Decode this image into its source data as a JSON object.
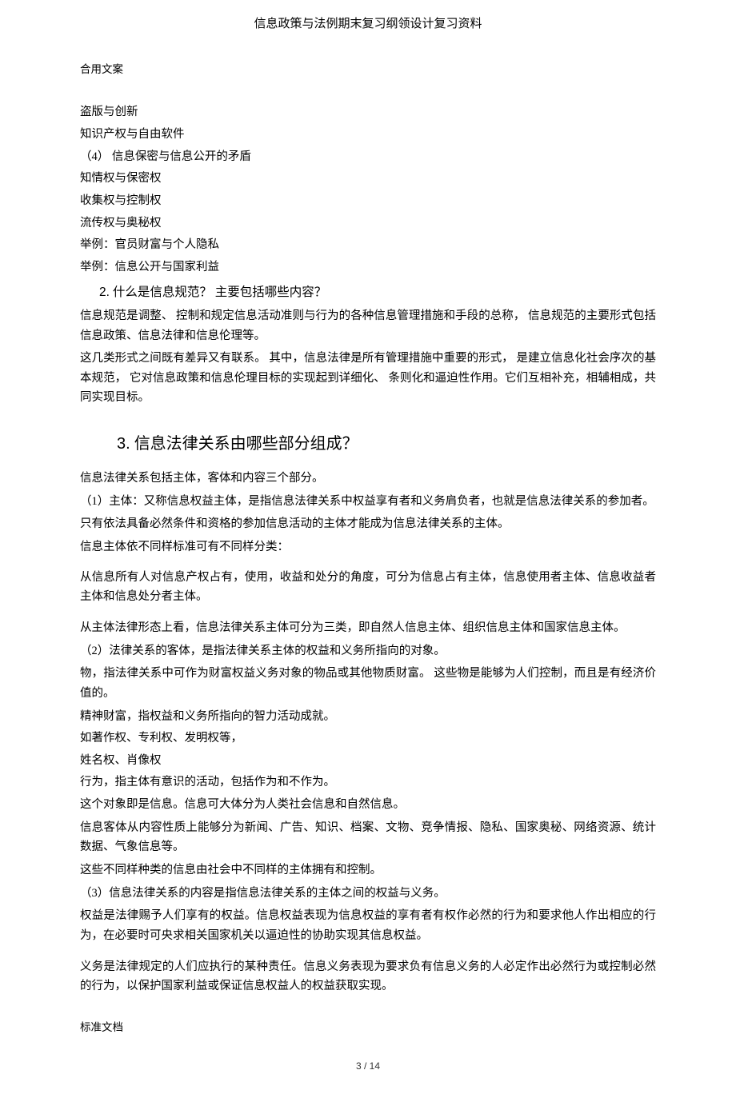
{
  "header": {
    "title": "信息政策与法例期末复习纲领设计复习资料"
  },
  "meta": {
    "top": "合用文案",
    "bottom": "标准文档"
  },
  "body": {
    "l1": "盗版与创新",
    "l2": "知识产权与自由软件",
    "l3": "（4）  信息保密与信息公开的矛盾",
    "l4": "知情权与保密权",
    "l5": "收集权与控制权",
    "l6": "流传权与奥秘权",
    "l7": "举例：官员财富与个人隐私",
    "l8": "举例：信息公开与国家利益",
    "sec2_num": "2.",
    "sec2_title": "什么是信息规范？  主要包括哪些内容？",
    "p1": "信息规范是调整、  控制和规定信息活动准则与行为的各种信息管理措施和手段的总称，          信息规范的主要形式包括信息政策、信息法律和信息伦理等。",
    "p2": "这几类形式之间既有差异又有联系。  其中，信息法律是所有管理措施中重要的形式，  是建立信息化社会序次的基本规范，  它对信息政策和信息伦理目标的实现起到详细化、  条则化和逼迫性作用。它们互相补充，相辅相成，共同实现目标。",
    "sec3_num": "3.",
    "sec3_title": "信息法律关系由哪些部分组成？",
    "p3": "信息法律关系包括主体，客体和内容三个部分。",
    "p4": "（1）主体：又称信息权益主体，是指信息法律关系中权益享有者和义务肩负者，也就是信息法律关系的参加者。",
    "p5": "只有依法具备必然条件和资格的参加信息活动的主体才能成为信息法律关系的主体。",
    "p6": "信息主体依不同样标准可有不同样分类：",
    "p7": "从信息所有人对信息产权占有，使用，收益和处分的角度，可分为信息占有主体，信息使用者主体、信息收益者主体和信息处分者主体。",
    "p8": "从主体法律形态上看，信息法律关系主体可分为三类，即自然人信息主体、组织信息主体和国家信息主体。",
    "p9": "（2）法律关系的客体，是指法律关系主体的权益和义务所指向的对象。",
    "p10": "物，指法律关系中可作为财富权益义务对象的物品或其他物质财富。  这些物是能够为人们控制，而且是有经济价值的。",
    "p11": "精神财富，指权益和义务所指向的智力活动成就。",
    "p12": "如著作权、专利权、发明权等，",
    "p13": "姓名权、肖像权",
    "p14": "行为，指主体有意识的活动，包括作为和不作为。",
    "p15": "这个对象即是信息。信息可大体分为人类社会信息和自然信息。",
    "p16": "信息客体从内容性质上能够分为新闻、广告、知识、档案、文物、竞争情报、隐私、国家奥秘、网络资源、统计数据、气象信息等。",
    "p17": "这些不同样种类的信息由社会中不同样的主体拥有和控制。",
    "p18": "（3）信息法律关系的内容是指信息法律关系的主体之间的权益与义务。",
    "p19": "权益是法律赐予人们享有的权益。信息权益表现为信息权益的享有者有权作必然的行为和要求他人作出相应的行为，在必要时可央求相关国家机关以逼迫性的协助实现其信息权益。",
    "p20": "义务是法律规定的人们应执行的某种责任。信息义务表现为要求负有信息义务的人必定作出必然行为或控制必然的行为，以保护国家利益或保证信息权益人的权益获取实现。"
  },
  "footer": {
    "page": "3 / 14"
  }
}
